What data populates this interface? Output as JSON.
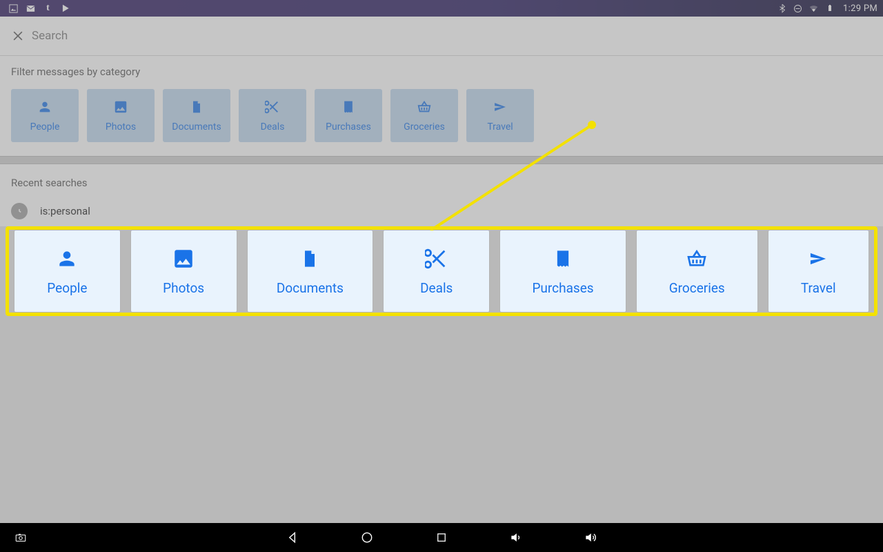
{
  "status": {
    "clock": "1:29 PM",
    "left_icons": [
      "image-icon",
      "mail-icon",
      "tumblr-icon",
      "play-icon"
    ],
    "right_icons": [
      "bluetooth-icon",
      "do-not-disturb-icon",
      "wifi-icon",
      "battery-icon"
    ]
  },
  "header": {
    "search_placeholder": "Search"
  },
  "filter": {
    "title": "Filter messages by category",
    "chips": [
      {
        "icon": "person-icon",
        "label": "People"
      },
      {
        "icon": "photo-icon",
        "label": "Photos"
      },
      {
        "icon": "document-icon",
        "label": "Documents"
      },
      {
        "icon": "scissors-icon",
        "label": "Deals"
      },
      {
        "icon": "receipt-icon",
        "label": "Purchases"
      },
      {
        "icon": "basket-icon",
        "label": "Groceries"
      },
      {
        "icon": "plane-icon",
        "label": "Travel"
      }
    ]
  },
  "recent": {
    "title": "Recent searches",
    "items": [
      "is:personal"
    ]
  },
  "popup": {
    "cards": [
      {
        "icon": "person-icon",
        "label": "People"
      },
      {
        "icon": "photo-icon",
        "label": "Photos"
      },
      {
        "icon": "document-icon",
        "label": "Documents"
      },
      {
        "icon": "scissors-icon",
        "label": "Deals"
      },
      {
        "icon": "receipt-icon",
        "label": "Purchases"
      },
      {
        "icon": "basket-icon",
        "label": "Groceries"
      },
      {
        "icon": "plane-icon",
        "label": "Travel"
      }
    ]
  },
  "colors": {
    "accent": "#1a73e8",
    "highlight": "#f3e100"
  }
}
